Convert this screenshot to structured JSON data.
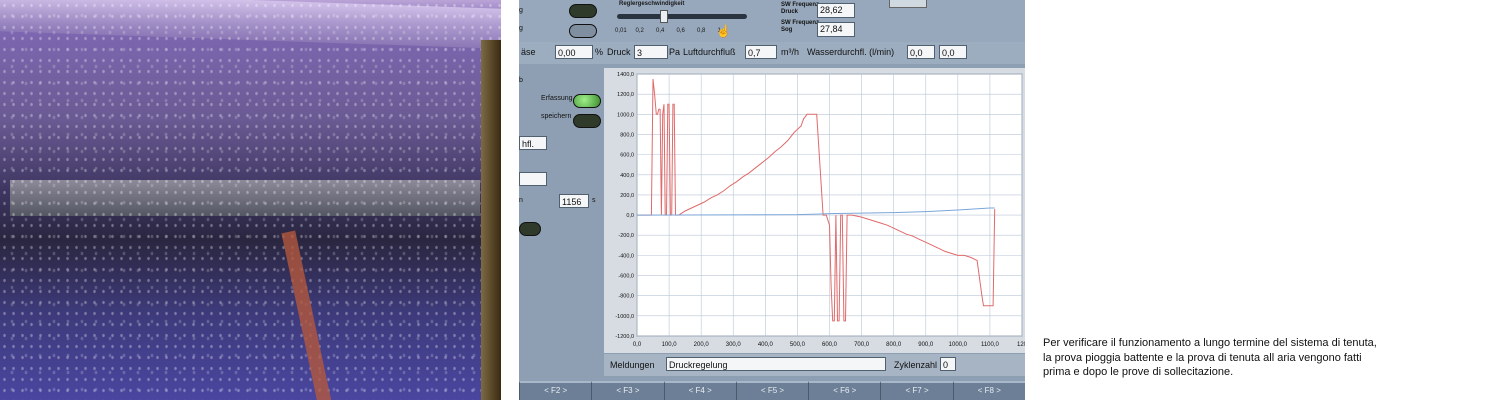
{
  "screen": {
    "slider": {
      "label": "Reglergeschwindigkeit",
      "ticks": [
        "0,01",
        "0,2",
        "0,4",
        "0,6",
        "0,8",
        "1"
      ],
      "value": 0.35
    },
    "sw": {
      "druck_label_1": "SW Frequenz",
      "druck_label_2": "Druck",
      "druck_value": "28,62",
      "sog_label_1": "SW Frequenz",
      "sog_label_2": "Sog",
      "sog_value": "27,84"
    },
    "status": {
      "left_label": "äse",
      "left_value": "0,00",
      "left_unit": "%",
      "druck_label": "Druck",
      "druck_value": "3",
      "druck_unit": "Pa",
      "luft_label": "Luftdurchfluß",
      "luft_value": "0,7",
      "luft_unit": "m³/h",
      "wasser_label": "Wasserdurchfl. (l/min)",
      "wasser_value_1": "0,0",
      "wasser_value_2": "0,0"
    },
    "left": {
      "label_b": "b",
      "erfassung_label": "Erfassung",
      "speichern_label": "speichern",
      "field_1": "hfl.",
      "field_2": "",
      "n_label": "n",
      "seconds_value": "1156",
      "seconds_unit": "s",
      "left_top_1": "g",
      "left_top_2": "g"
    },
    "meldungen": {
      "label": "Meldungen",
      "value": "Druckregelung",
      "zyklen_label": "Zyklenzahl",
      "zyklen_value": "0"
    },
    "fkeys": [
      "< F2 >",
      "< F3 >",
      "< F4 >",
      "< F5 >",
      "< F6 >",
      "< F7 >",
      "< F8 >"
    ],
    "colors": {
      "pressure_series": "#e06a6a",
      "flow_series": "#7aa6d9",
      "grid": "#b9c6d8"
    }
  },
  "chart_data": {
    "type": "line",
    "xlim": [
      0,
      1200
    ],
    "ylim": [
      -1200,
      1400
    ],
    "x_ticks": [
      "0,0",
      "100,0",
      "200,0",
      "300,0",
      "400,0",
      "500,0",
      "600,0",
      "700,0",
      "800,0",
      "900,0",
      "1000,0",
      "1100,0",
      "120"
    ],
    "y_ticks": [
      "1400,0",
      "1200,0",
      "1000,0",
      "800,0",
      "600,0",
      "400,0",
      "200,0",
      "0,0",
      "-200,0",
      "-400,0",
      "-600,0",
      "-800,0",
      "-1000,0",
      "-1200,0"
    ],
    "series": [
      {
        "x": [
          0,
          45,
          50,
          55,
          60,
          64,
          68,
          72,
          76,
          80,
          84,
          88,
          92,
          96,
          100,
          104,
          108,
          112,
          116,
          120,
          130,
          150,
          170,
          190,
          210,
          230,
          250,
          270,
          290,
          310,
          330,
          350,
          370,
          390,
          410,
          430,
          450,
          470,
          490,
          510,
          511,
          520,
          521,
          530,
          531,
          540,
          541,
          560,
          580,
          590,
          600,
          605,
          610,
          615,
          620,
          625,
          630,
          635,
          640,
          645,
          650,
          655,
          660,
          670,
          700,
          720,
          740,
          760,
          780,
          800,
          820,
          840,
          860,
          880,
          900,
          920,
          940,
          960,
          980,
          1000,
          1020,
          1040,
          1060,
          1075,
          1080,
          1095,
          1110,
          1115
        ],
        "y": [
          0,
          0,
          1350,
          1200,
          1000,
          1000,
          1050,
          1050,
          0,
          1000,
          1100,
          0,
          0,
          1100,
          1100,
          0,
          0,
          1100,
          1100,
          0,
          0,
          40,
          70,
          100,
          130,
          170,
          200,
          240,
          290,
          330,
          380,
          420,
          470,
          520,
          570,
          630,
          680,
          740,
          820,
          880,
          880,
          960,
          960,
          1000,
          1000,
          1000,
          1000,
          1000,
          0,
          0,
          -100,
          -700,
          -1050,
          -1050,
          0,
          -1050,
          -1050,
          0,
          0,
          -1050,
          -1050,
          0,
          0,
          0,
          -20,
          -40,
          -60,
          -80,
          -100,
          -130,
          -160,
          -190,
          -210,
          -240,
          -270,
          -300,
          -330,
          -360,
          -380,
          -400,
          -400,
          -420,
          -450,
          -800,
          -900,
          -900,
          -900,
          60
        ],
        "name": ""
      },
      {
        "x": [
          0,
          500,
          560,
          600,
          700,
          800,
          900,
          1000,
          1100,
          1115
        ],
        "y": [
          0,
          5,
          10,
          15,
          20,
          25,
          35,
          50,
          70,
          70
        ],
        "name": ""
      }
    ]
  },
  "caption": {
    "line1": "Per verificare il funzionamento a lungo termine del sistema di tenuta,",
    "line2": "la prova pioggia battente e la prova di tenuta all aria vengono fatti",
    "line3": "prima e dopo le prove di sollecitazione."
  }
}
